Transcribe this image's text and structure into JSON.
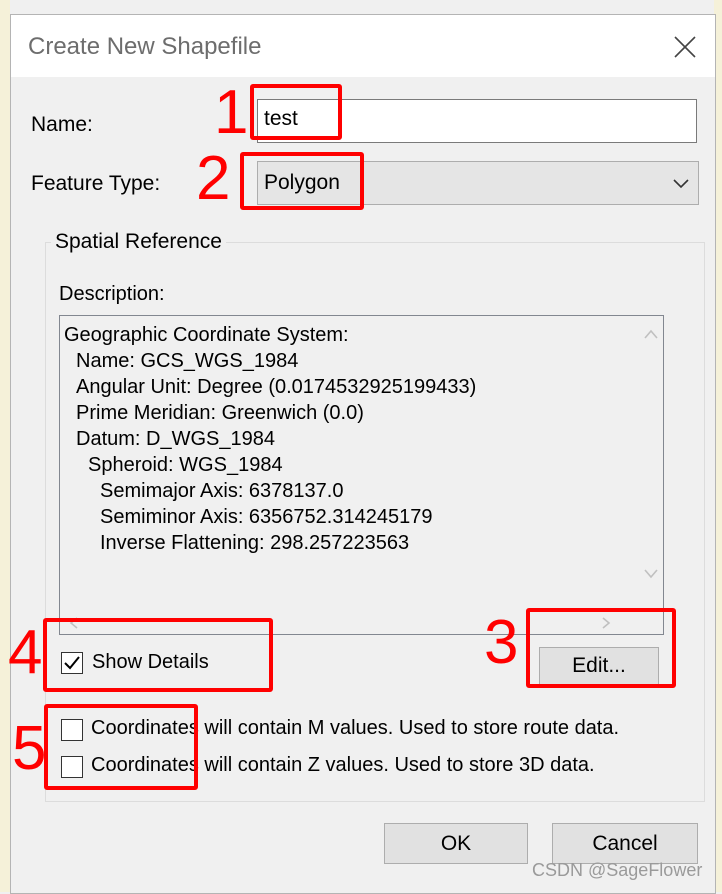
{
  "window": {
    "title": "Create New Shapefile"
  },
  "fields": {
    "name_label": "Name:",
    "name_value": "test",
    "feature_type_label": "Feature Type:",
    "feature_type_value": "Polygon"
  },
  "spatial_reference": {
    "group_title": "Spatial Reference",
    "description_label": "Description:",
    "description_lines": [
      "Geographic Coordinate System:",
      "Name: GCS_WGS_1984",
      "Angular Unit: Degree (0.0174532925199433)",
      "Prime Meridian: Greenwich (0.0)",
      "Datum: D_WGS_1984",
      "Spheroid: WGS_1984",
      "Semimajor Axis: 6378137.0",
      "Semiminor Axis: 6356752.314245179",
      "Inverse Flattening: 298.257223563"
    ],
    "show_details_label": "Show Details",
    "show_details_checked": true,
    "edit_button": "Edit..."
  },
  "options": {
    "m_values_label": "Coordinates will contain M values. Used to store route data.",
    "z_values_label": "Coordinates will contain Z values. Used to store 3D data."
  },
  "buttons": {
    "ok": "OK",
    "cancel": "Cancel"
  },
  "annotations": [
    "1",
    "2",
    "3",
    "4",
    "5"
  ],
  "annotation_color": "#ff0000",
  "watermark": "CSDN @SageFlower"
}
